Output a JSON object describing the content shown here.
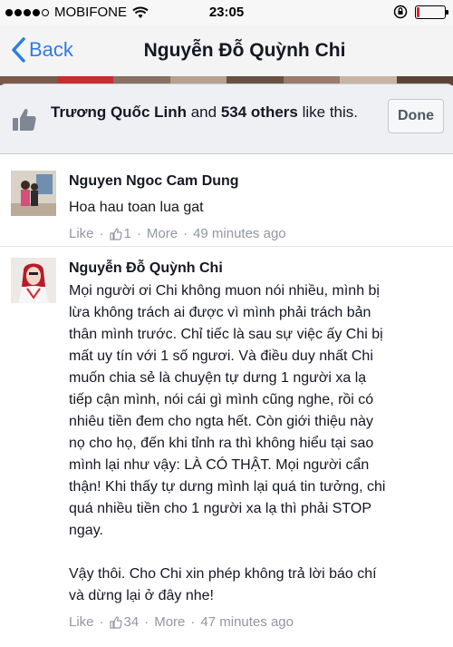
{
  "status_bar": {
    "carrier": "MOBIFONE",
    "time": "23:05",
    "battery_level": 0.12,
    "signal_bars": 4,
    "signal_max": 5
  },
  "nav": {
    "back_label": "Back",
    "title": "Nguyễn Đỗ Quỳnh Chi",
    "accent_color": "#2d7de2"
  },
  "likes": {
    "first_name": "Trương Quốc Linh",
    "connector": " and ",
    "others_count": "534 others",
    "suffix": " like this.",
    "done_label": "Done"
  },
  "comments": [
    {
      "author": "Nguyen Ngoc Cam Dung",
      "text": "Hoa hau toan lua gat",
      "like_label": "Like",
      "like_count": "1",
      "more_label": "More",
      "time": "49 minutes ago"
    },
    {
      "author": "Nguyễn Đỗ Quỳnh Chi",
      "text": "Mọi người ơi Chi không muon nói nhiều, mình bị\nlừa không trách ai được vì mình phải trách bản\nthân mình trước. Chỉ tiếc là sau sự việc ấy Chi bị\nmất uy tín với 1 số ngươi. Và điều duy nhất Chi\nmuốn chia sẻ là chuyện tự dưng 1 người xa lạ\ntiếp cận mình, nói cái gì mình cũng nghe, rồi có\nnhiêu tiền đem cho ngta hết. Còn giới thiệu này\nnọ cho họ, đến khi tỉnh ra thì không hiểu tại sao\nmình lại như vậy: LÀ CÓ THẬT. Mọi người cẩn\nthận! Khi thấy tự dưng mình lại quá tin tưởng, chi\nquá nhiều tiền cho 1 người xa lạ thì phải STOP\nngay.\n\nVậy thôi. Cho Chi xin phép không trả lời báo chí\nvà dừng lại ở đây nhe!",
      "like_label": "Like",
      "like_count": "34",
      "more_label": "More",
      "time": "47 minutes ago"
    }
  ],
  "icons": {
    "back": "chevron-left-icon",
    "likes": "thumbs-up-icon",
    "comment_like": "thumbs-up-outline-icon"
  }
}
